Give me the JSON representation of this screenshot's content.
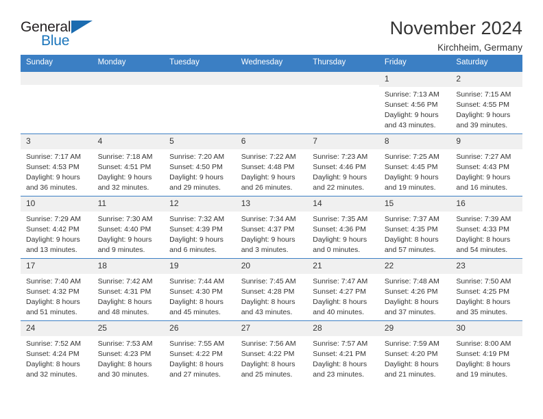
{
  "brand": {
    "name_part1": "General",
    "name_part2": "Blue",
    "accent_color": "#1b75bb",
    "triangle_color": "#1b6cb0"
  },
  "header": {
    "title": "November 2024",
    "subtitle": "Kirchheim, Germany"
  },
  "calendar": {
    "header_bg": "#3b7fc4",
    "day_band_bg": "#f0f0f0",
    "weekday_headers": [
      "Sunday",
      "Monday",
      "Tuesday",
      "Wednesday",
      "Thursday",
      "Friday",
      "Saturday"
    ],
    "weeks": [
      [
        {
          "day": "",
          "empty": true
        },
        {
          "day": "",
          "empty": true
        },
        {
          "day": "",
          "empty": true
        },
        {
          "day": "",
          "empty": true
        },
        {
          "day": "",
          "empty": true
        },
        {
          "day": "1",
          "sunrise": "Sunrise: 7:13 AM",
          "sunset": "Sunset: 4:56 PM",
          "daylight": "Daylight: 9 hours and 43 minutes."
        },
        {
          "day": "2",
          "sunrise": "Sunrise: 7:15 AM",
          "sunset": "Sunset: 4:55 PM",
          "daylight": "Daylight: 9 hours and 39 minutes."
        }
      ],
      [
        {
          "day": "3",
          "sunrise": "Sunrise: 7:17 AM",
          "sunset": "Sunset: 4:53 PM",
          "daylight": "Daylight: 9 hours and 36 minutes."
        },
        {
          "day": "4",
          "sunrise": "Sunrise: 7:18 AM",
          "sunset": "Sunset: 4:51 PM",
          "daylight": "Daylight: 9 hours and 32 minutes."
        },
        {
          "day": "5",
          "sunrise": "Sunrise: 7:20 AM",
          "sunset": "Sunset: 4:50 PM",
          "daylight": "Daylight: 9 hours and 29 minutes."
        },
        {
          "day": "6",
          "sunrise": "Sunrise: 7:22 AM",
          "sunset": "Sunset: 4:48 PM",
          "daylight": "Daylight: 9 hours and 26 minutes."
        },
        {
          "day": "7",
          "sunrise": "Sunrise: 7:23 AM",
          "sunset": "Sunset: 4:46 PM",
          "daylight": "Daylight: 9 hours and 22 minutes."
        },
        {
          "day": "8",
          "sunrise": "Sunrise: 7:25 AM",
          "sunset": "Sunset: 4:45 PM",
          "daylight": "Daylight: 9 hours and 19 minutes."
        },
        {
          "day": "9",
          "sunrise": "Sunrise: 7:27 AM",
          "sunset": "Sunset: 4:43 PM",
          "daylight": "Daylight: 9 hours and 16 minutes."
        }
      ],
      [
        {
          "day": "10",
          "sunrise": "Sunrise: 7:29 AM",
          "sunset": "Sunset: 4:42 PM",
          "daylight": "Daylight: 9 hours and 13 minutes."
        },
        {
          "day": "11",
          "sunrise": "Sunrise: 7:30 AM",
          "sunset": "Sunset: 4:40 PM",
          "daylight": "Daylight: 9 hours and 9 minutes."
        },
        {
          "day": "12",
          "sunrise": "Sunrise: 7:32 AM",
          "sunset": "Sunset: 4:39 PM",
          "daylight": "Daylight: 9 hours and 6 minutes."
        },
        {
          "day": "13",
          "sunrise": "Sunrise: 7:34 AM",
          "sunset": "Sunset: 4:37 PM",
          "daylight": "Daylight: 9 hours and 3 minutes."
        },
        {
          "day": "14",
          "sunrise": "Sunrise: 7:35 AM",
          "sunset": "Sunset: 4:36 PM",
          "daylight": "Daylight: 9 hours and 0 minutes."
        },
        {
          "day": "15",
          "sunrise": "Sunrise: 7:37 AM",
          "sunset": "Sunset: 4:35 PM",
          "daylight": "Daylight: 8 hours and 57 minutes."
        },
        {
          "day": "16",
          "sunrise": "Sunrise: 7:39 AM",
          "sunset": "Sunset: 4:33 PM",
          "daylight": "Daylight: 8 hours and 54 minutes."
        }
      ],
      [
        {
          "day": "17",
          "sunrise": "Sunrise: 7:40 AM",
          "sunset": "Sunset: 4:32 PM",
          "daylight": "Daylight: 8 hours and 51 minutes."
        },
        {
          "day": "18",
          "sunrise": "Sunrise: 7:42 AM",
          "sunset": "Sunset: 4:31 PM",
          "daylight": "Daylight: 8 hours and 48 minutes."
        },
        {
          "day": "19",
          "sunrise": "Sunrise: 7:44 AM",
          "sunset": "Sunset: 4:30 PM",
          "daylight": "Daylight: 8 hours and 45 minutes."
        },
        {
          "day": "20",
          "sunrise": "Sunrise: 7:45 AM",
          "sunset": "Sunset: 4:28 PM",
          "daylight": "Daylight: 8 hours and 43 minutes."
        },
        {
          "day": "21",
          "sunrise": "Sunrise: 7:47 AM",
          "sunset": "Sunset: 4:27 PM",
          "daylight": "Daylight: 8 hours and 40 minutes."
        },
        {
          "day": "22",
          "sunrise": "Sunrise: 7:48 AM",
          "sunset": "Sunset: 4:26 PM",
          "daylight": "Daylight: 8 hours and 37 minutes."
        },
        {
          "day": "23",
          "sunrise": "Sunrise: 7:50 AM",
          "sunset": "Sunset: 4:25 PM",
          "daylight": "Daylight: 8 hours and 35 minutes."
        }
      ],
      [
        {
          "day": "24",
          "sunrise": "Sunrise: 7:52 AM",
          "sunset": "Sunset: 4:24 PM",
          "daylight": "Daylight: 8 hours and 32 minutes."
        },
        {
          "day": "25",
          "sunrise": "Sunrise: 7:53 AM",
          "sunset": "Sunset: 4:23 PM",
          "daylight": "Daylight: 8 hours and 30 minutes."
        },
        {
          "day": "26",
          "sunrise": "Sunrise: 7:55 AM",
          "sunset": "Sunset: 4:22 PM",
          "daylight": "Daylight: 8 hours and 27 minutes."
        },
        {
          "day": "27",
          "sunrise": "Sunrise: 7:56 AM",
          "sunset": "Sunset: 4:22 PM",
          "daylight": "Daylight: 8 hours and 25 minutes."
        },
        {
          "day": "28",
          "sunrise": "Sunrise: 7:57 AM",
          "sunset": "Sunset: 4:21 PM",
          "daylight": "Daylight: 8 hours and 23 minutes."
        },
        {
          "day": "29",
          "sunrise": "Sunrise: 7:59 AM",
          "sunset": "Sunset: 4:20 PM",
          "daylight": "Daylight: 8 hours and 21 minutes."
        },
        {
          "day": "30",
          "sunrise": "Sunrise: 8:00 AM",
          "sunset": "Sunset: 4:19 PM",
          "daylight": "Daylight: 8 hours and 19 minutes."
        }
      ]
    ]
  }
}
